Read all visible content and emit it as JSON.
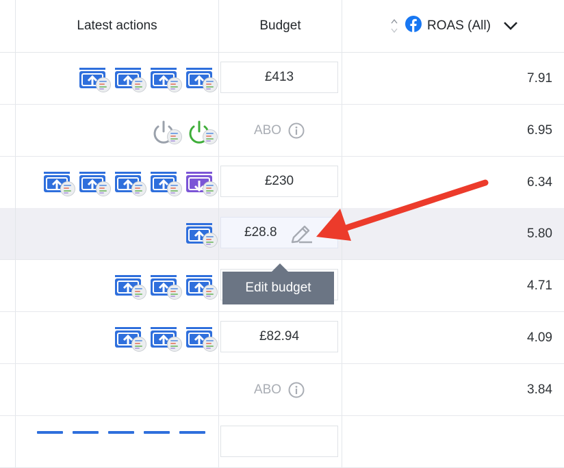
{
  "header": {
    "latest_actions": "Latest actions",
    "budget": "Budget",
    "roas": "ROAS (All)"
  },
  "rows": [
    {
      "actions": [
        "budget-up",
        "budget-up",
        "budget-up",
        "budget-up"
      ],
      "budget": "£413",
      "roas": "7.91"
    },
    {
      "actions": [
        "power-off",
        "power-on"
      ],
      "budget": "ABO",
      "roas": "6.95"
    },
    {
      "actions": [
        "budget-up",
        "budget-up",
        "budget-up",
        "budget-up",
        "budget-down"
      ],
      "budget": "£230",
      "roas": "6.34"
    },
    {
      "actions": [
        "budget-up"
      ],
      "budget": "£28.8",
      "roas": "5.80"
    },
    {
      "actions": [
        "budget-up",
        "budget-up",
        "budget-up"
      ],
      "budget": "",
      "roas": "4.71"
    },
    {
      "actions": [
        "budget-up",
        "budget-up",
        "budget-up"
      ],
      "budget": "£82.94",
      "roas": "4.09"
    },
    {
      "actions": [],
      "budget": "ABO",
      "roas": "3.84"
    }
  ],
  "tooltip": "Edit budget",
  "colors": {
    "up": "#2f6fdc",
    "down": "#7b55d6",
    "power_off": "#9aa1ab",
    "power_on": "#3fae3a",
    "arrow": "#ec3b2b",
    "facebook": "#1877f2"
  }
}
